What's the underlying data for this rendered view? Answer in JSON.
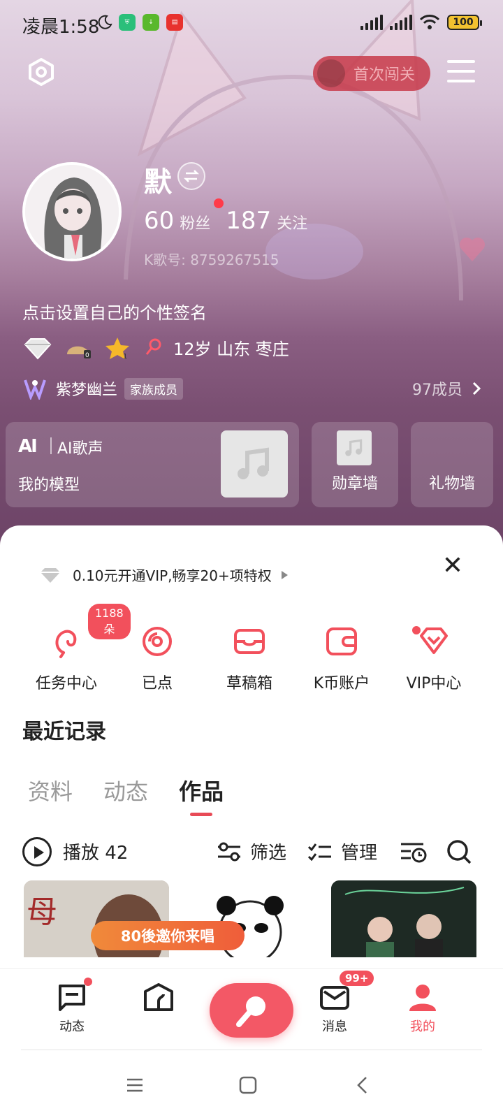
{
  "status_bar": {
    "time": "凌晨1:58",
    "battery": "100"
  },
  "header": {
    "challenge_label": "首次闯关"
  },
  "profile": {
    "name": "默",
    "fans_count": "60",
    "fans_label": "粉丝",
    "following_count": "187",
    "following_label": "关注",
    "k_id": "K歌号: 8759267515",
    "signature": "点击设置自己的个性签名",
    "age_location": "12岁  山东  枣庄",
    "family_name": "紫梦幽兰",
    "family_tag": "家族成员",
    "family_members": "97成员"
  },
  "cards": {
    "ai_logo": "AI",
    "ai_title": "AI歌声",
    "ai_subtitle": "我的模型",
    "medal_wall": "勋章墙",
    "gift_wall": "礼物墙"
  },
  "vip_banner": {
    "text": "0.10元开通VIP,畅享20+项特权"
  },
  "shortcuts": [
    {
      "label": "任务中心",
      "badge": "1188朵",
      "icon": "flower-icon"
    },
    {
      "label": "已点",
      "icon": "disc-icon"
    },
    {
      "label": "草稿箱",
      "icon": "inbox-icon"
    },
    {
      "label": "K币账户",
      "icon": "wallet-icon"
    },
    {
      "label": "VIP中心",
      "icon": "diamond-icon"
    }
  ],
  "recent": {
    "title": "最近记录"
  },
  "tabs": [
    {
      "label": "资料"
    },
    {
      "label": "动态"
    },
    {
      "label": "作品",
      "active": true
    }
  ],
  "works_toolbar": {
    "play_label": "播放",
    "play_count": "42",
    "filter_label": "筛选",
    "manage_label": "管理"
  },
  "promo": {
    "text": "80後邀你来唱"
  },
  "bottom_nav": {
    "feed": "动态",
    "home": "",
    "messages": "消息",
    "messages_badge": "99+",
    "me": "我的"
  },
  "colors": {
    "accent": "#f2505c",
    "hero": "#8a5e82"
  }
}
